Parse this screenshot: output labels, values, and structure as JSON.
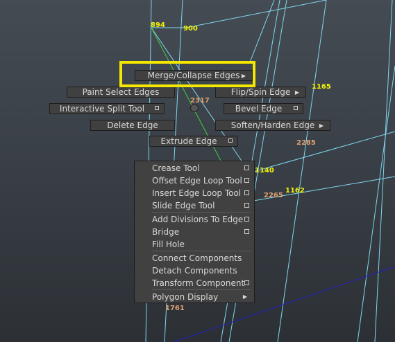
{
  "viewport": {
    "vertex_labels_yellow": [
      "894",
      "900",
      "1165",
      "1140",
      "1162"
    ],
    "vertex_labels_orange": [
      "2317",
      "2285",
      "2265",
      "1761"
    ]
  },
  "marking_menu": {
    "merge": "Merge/Collapse Edges",
    "paint_select": "Paint Select Edges",
    "flip_spin": "Flip/Spin Edge",
    "interactive_split": "Interactive Split Tool",
    "bevel": "Bevel Edge",
    "delete": "Delete Edge",
    "soften_harden": "Soften/Harden Edge",
    "extrude": "Extrude Edge"
  },
  "context_menu": {
    "items": [
      "Crease Tool",
      "Offset Edge Loop Tool",
      "Insert Edge Loop Tool",
      "Slide Edge Tool",
      "Add Divisions To Edge",
      "Bridge",
      "Fill Hole",
      "Connect Components",
      "Detach Components",
      "Transform Component",
      "Polygon Display"
    ]
  },
  "icons": {
    "option_box": "option-box-icon",
    "submenu_arrow": "submenu-arrow-icon"
  },
  "colors": {
    "background": "#3f454c",
    "wire_cyan": "#7fd8f0",
    "edge_green": "#40d040",
    "highlight": "#f5e800",
    "label_yellow": "#f2f20a",
    "label_orange": "#e0a070"
  }
}
